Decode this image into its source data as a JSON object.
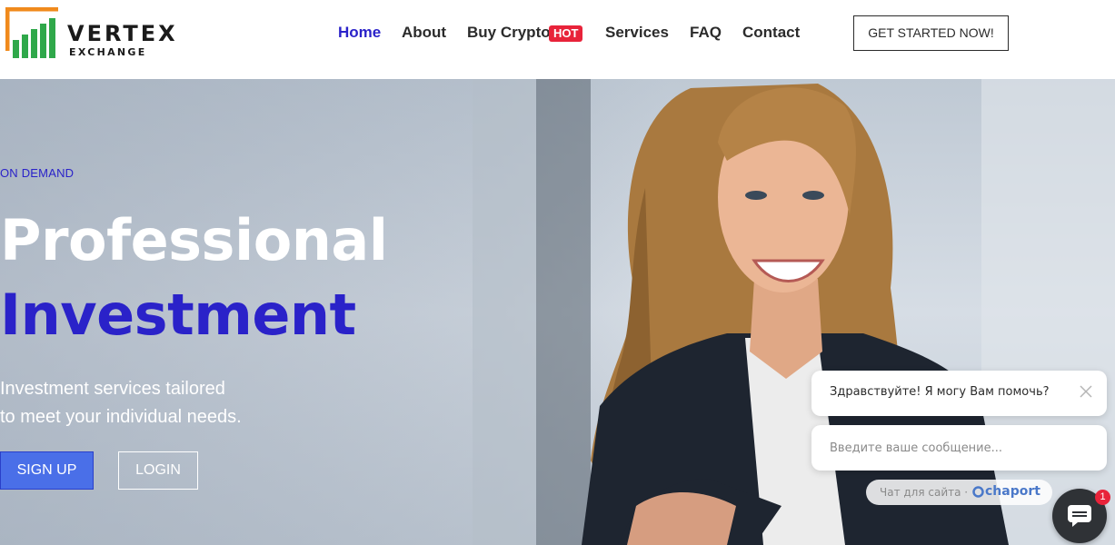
{
  "brand": {
    "name": "VERTEX",
    "subtitle": "EXCHANGE",
    "accent_color": "#2a22c9",
    "logo_orange": "#f08a1c",
    "logo_green": "#2fa84a"
  },
  "nav": {
    "items": [
      {
        "label": "Home",
        "active": true
      },
      {
        "label": "About",
        "active": false
      },
      {
        "label": "Buy Crypto",
        "active": false
      },
      {
        "label": "Services",
        "active": false
      },
      {
        "label": "FAQ",
        "active": false
      },
      {
        "label": "Contact",
        "active": false
      }
    ],
    "hot_badge": "HOT",
    "cta": "GET STARTED NOW!"
  },
  "hero": {
    "kicker": "ON DEMAND",
    "title_line1": "Professional",
    "title_line2": "Investment",
    "description_line1": "Investment services tailored",
    "description_line2": "to meet your individual needs.",
    "signup_label": "SIGN UP",
    "login_label": "LOGIN"
  },
  "chat": {
    "greeting": "Здравствуйте! Я могу Вам помочь?",
    "input_placeholder": "Введите ваше сообщение...",
    "powered_by": "Чат для сайта ·",
    "brand_name": "chaport",
    "unread_count": "1"
  }
}
